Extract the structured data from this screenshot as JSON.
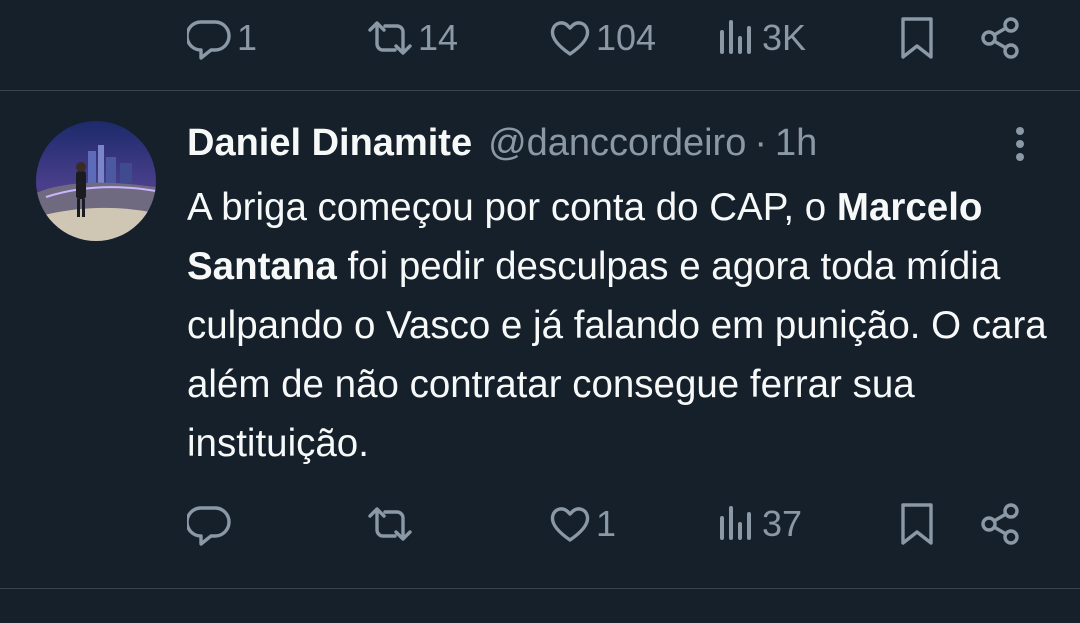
{
  "top_actions": {
    "reply_count": "1",
    "retweet_count": "14",
    "like_count": "104",
    "views_count": "3K"
  },
  "tweet": {
    "author": {
      "display_name": "Daniel Dinamite",
      "handle": "@danccordeiro"
    },
    "separator": "·",
    "timestamp": "1h",
    "text": {
      "part1": "A briga começou por conta do CAP, o ",
      "mention": "Marcelo Santana",
      "part2": " foi pedir desculpas e agora toda mídia culpando o Vasco e já falando em punição. O cara além de não contratar consegue ferrar sua instituição."
    },
    "actions": {
      "reply_count": "",
      "retweet_count": "",
      "like_count": "1",
      "views_count": "37"
    }
  },
  "icons": {
    "reply": "reply-icon",
    "retweet": "retweet-icon",
    "like": "heart-icon",
    "views": "views-icon",
    "bookmark": "bookmark-icon",
    "share": "share-icon",
    "more": "more-icon"
  },
  "colors": {
    "background": "#15202b",
    "text_primary": "#f7f9f9",
    "text_secondary": "#8b98a5",
    "divider": "#38444d"
  }
}
